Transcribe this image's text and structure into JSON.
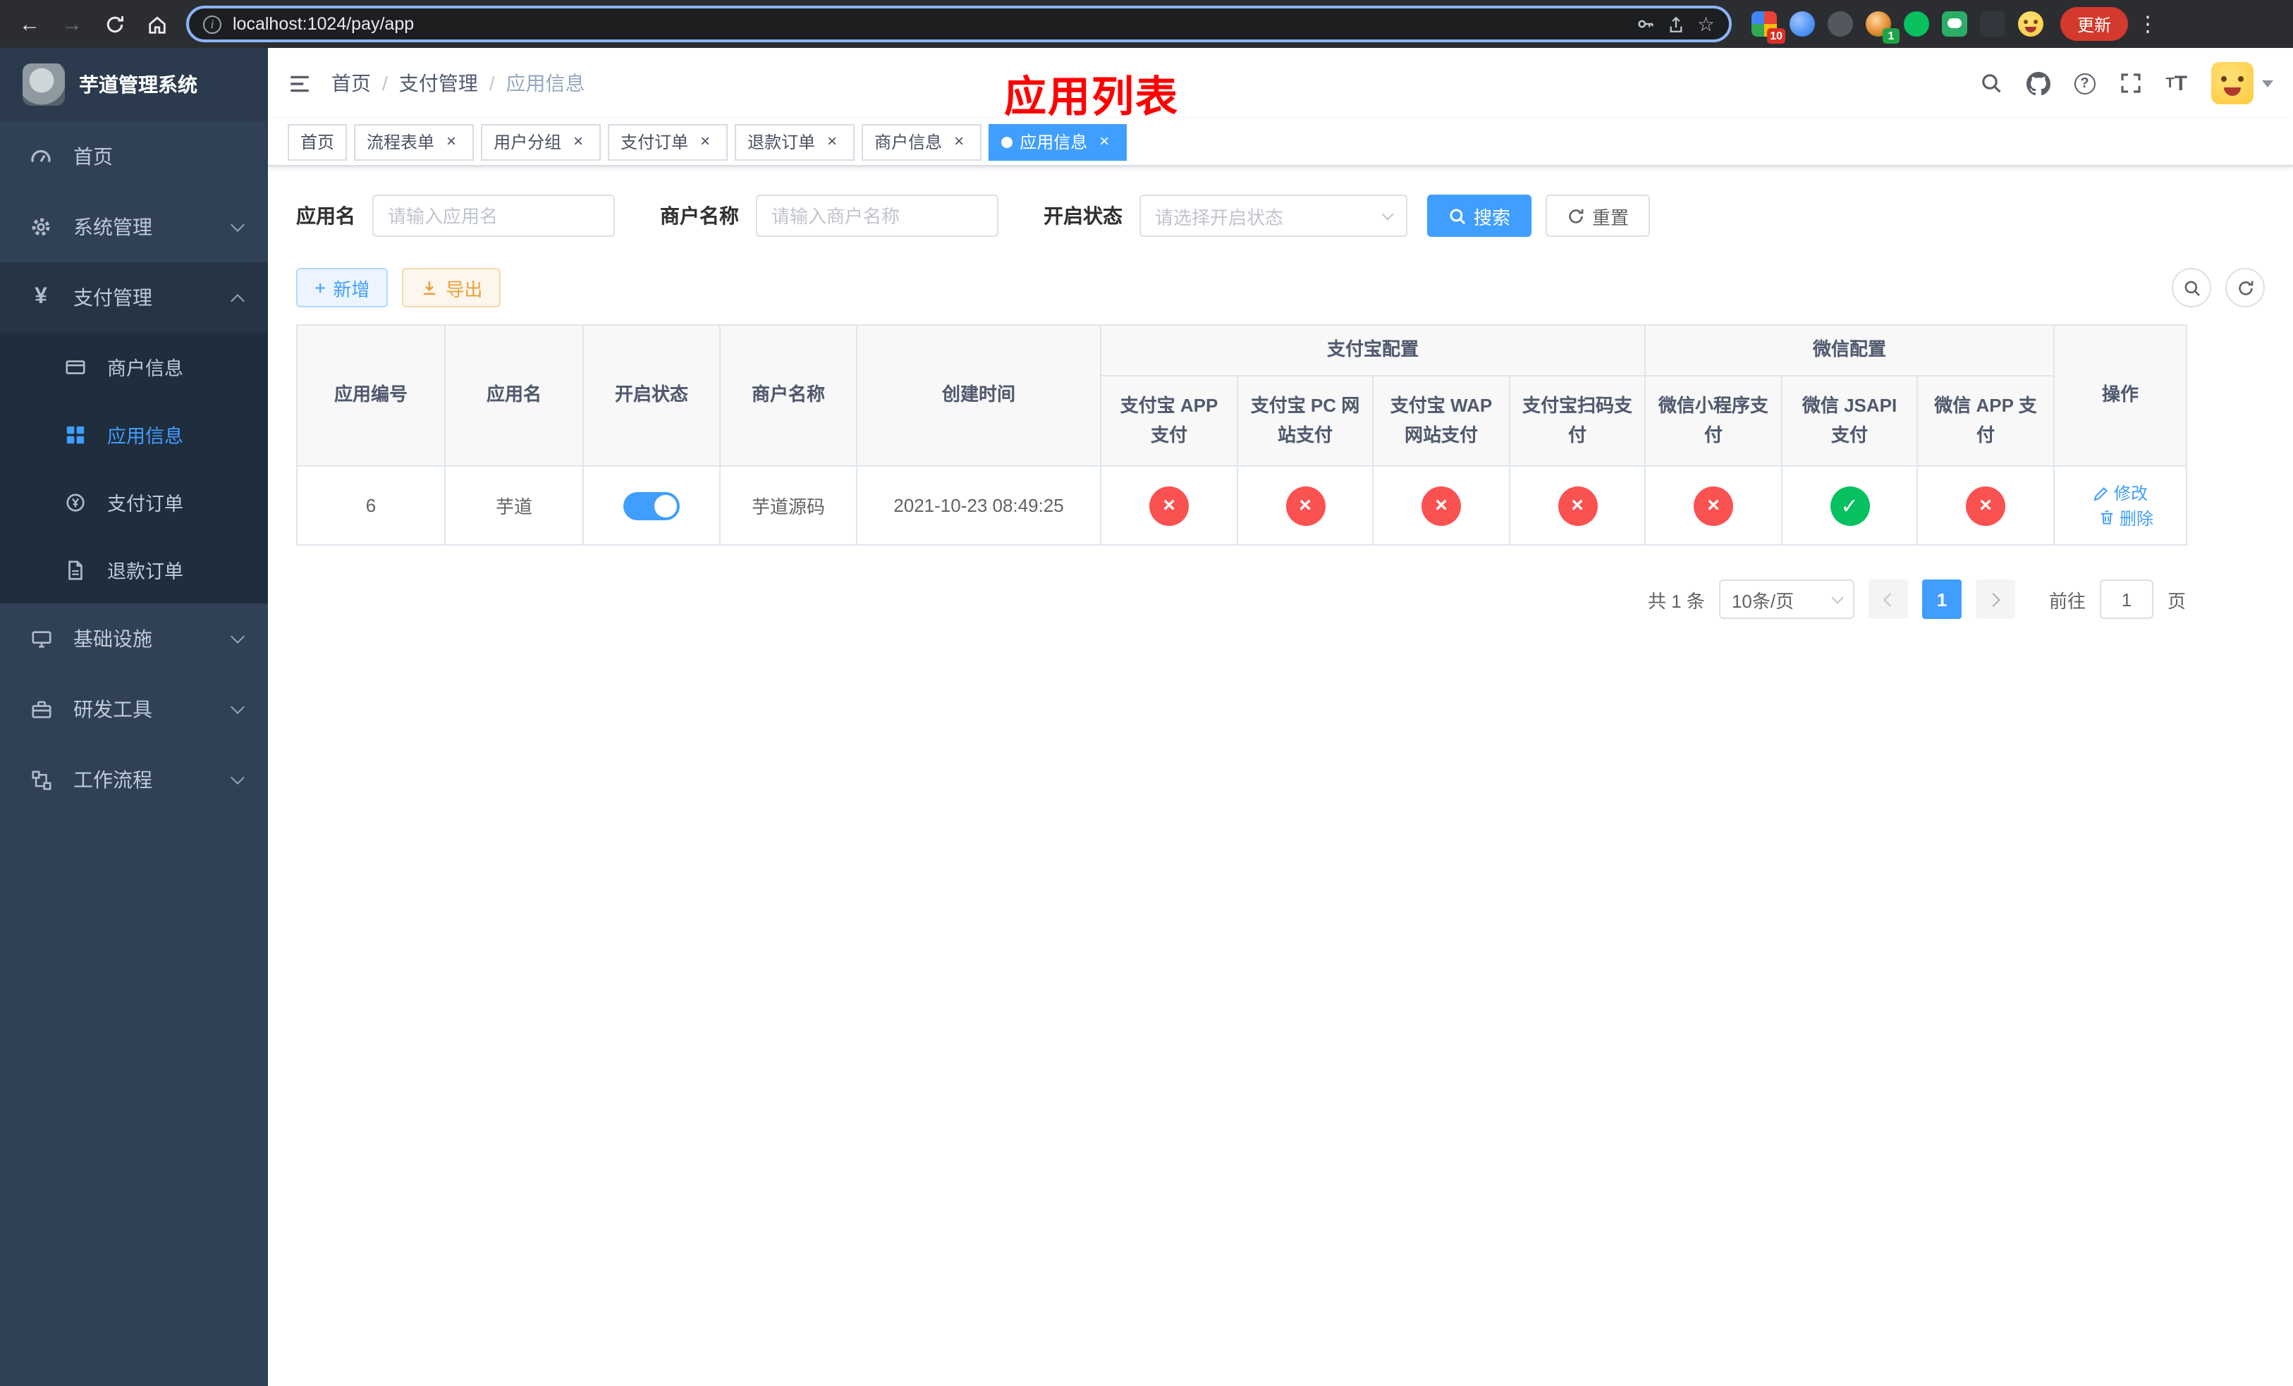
{
  "browser": {
    "url": "localhost:1024/pay/app",
    "update_button": "更新",
    "extension_badge_grid": "10",
    "extension_badge_avatar": "1"
  },
  "sidebar": {
    "title": "芋道管理系统",
    "items": {
      "home": "首页",
      "system": "系统管理",
      "payment": "支付管理",
      "merchant_info": "商户信息",
      "app_info": "应用信息",
      "payment_order": "支付订单",
      "refund_order": "退款订单",
      "infrastructure": "基础设施",
      "devtools": "研发工具",
      "workflow": "工作流程"
    }
  },
  "header": {
    "breadcrumb": [
      "首页",
      "支付管理",
      "应用信息"
    ],
    "separator": "/",
    "annotation_title": "应用列表"
  },
  "ui": {
    "close_glyph": "×"
  },
  "tabs": [
    {
      "label": "首页",
      "closable": false,
      "active": false
    },
    {
      "label": "流程表单",
      "closable": true,
      "active": false
    },
    {
      "label": "用户分组",
      "closable": true,
      "active": false
    },
    {
      "label": "支付订单",
      "closable": true,
      "active": false
    },
    {
      "label": "退款订单",
      "closable": true,
      "active": false
    },
    {
      "label": "商户信息",
      "closable": true,
      "active": false
    },
    {
      "label": "应用信息",
      "closable": true,
      "active": true
    }
  ],
  "filters": {
    "app_name_label": "应用名",
    "app_name_placeholder": "请输入应用名",
    "merchant_label": "商户名称",
    "merchant_placeholder": "请输入商户名称",
    "status_label": "开启状态",
    "status_placeholder": "请选择开启状态",
    "search_button": "搜索",
    "reset_button": "重置"
  },
  "toolbar": {
    "add_button": "新增",
    "export_button": "导出"
  },
  "table": {
    "groups": {
      "alipay": "支付宝配置",
      "wechat": "微信配置"
    },
    "columns": {
      "app_id": "应用编号",
      "app_name": "应用名",
      "status": "开启状态",
      "merchant": "商户名称",
      "created_at": "创建时间",
      "alipay_app": "支付宝 APP 支付",
      "alipay_pc": "支付宝 PC 网站支付",
      "alipay_wap": "支付宝 WAP 网站支付",
      "alipay_qr": "支付宝扫码支付",
      "wx_mini": "微信小程序支付",
      "wx_jsapi": "微信 JSAPI 支付",
      "wx_app": "微信 APP 支付",
      "actions": "操作"
    },
    "row": {
      "app_id": "6",
      "app_name": "芋道",
      "status_enabled": true,
      "merchant": "芋道源码",
      "created_at": "2021-10-23 08:49:25",
      "configs": {
        "alipay_app": false,
        "alipay_pc": false,
        "alipay_wap": false,
        "alipay_qr": false,
        "wx_mini": false,
        "wx_jsapi": true,
        "wx_app": false
      },
      "edit_label": "修改",
      "delete_label": "删除"
    },
    "glyphs": {
      "fail": "×",
      "success": "✓"
    }
  },
  "pagination": {
    "total": "共 1 条",
    "page_size": "10条/页",
    "page": "1",
    "goto_label": "前往",
    "goto_value": "1",
    "goto_unit": "页"
  },
  "colors": {
    "primary": "#409eff",
    "sidebar_bg": "#304156",
    "submenu_bg": "#1f2d3d",
    "fail": "#fa5151",
    "success": "#07c160",
    "annotation": "#fe0000",
    "update_button_bg": "#d3392c"
  }
}
